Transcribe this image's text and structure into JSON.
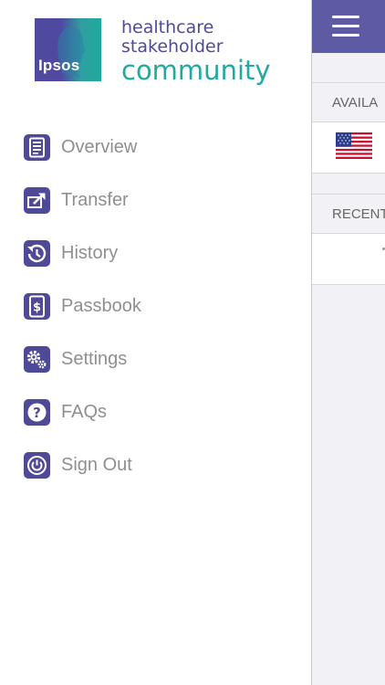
{
  "logo": {
    "badge_text": "Ipsos",
    "line1": "healthcare",
    "line2": "stakeholder",
    "line3": "community"
  },
  "menu": {
    "items": [
      {
        "label": "Overview",
        "icon": "overview-icon"
      },
      {
        "label": "Transfer",
        "icon": "transfer-icon"
      },
      {
        "label": "History",
        "icon": "history-icon"
      },
      {
        "label": "Passbook",
        "icon": "passbook-icon"
      },
      {
        "label": "Settings",
        "icon": "settings-icon"
      },
      {
        "label": "FAQs",
        "icon": "faq-icon"
      },
      {
        "label": "Sign Out",
        "icon": "sign-out-icon"
      }
    ]
  },
  "content": {
    "section1_header": "AVAILA",
    "section2_header": "RECENT"
  },
  "colors": {
    "brand_purple": "#4f4a98",
    "brand_teal": "#22a99d",
    "navbar": "#5c5ba4",
    "menu_text": "#8f8f8f"
  }
}
